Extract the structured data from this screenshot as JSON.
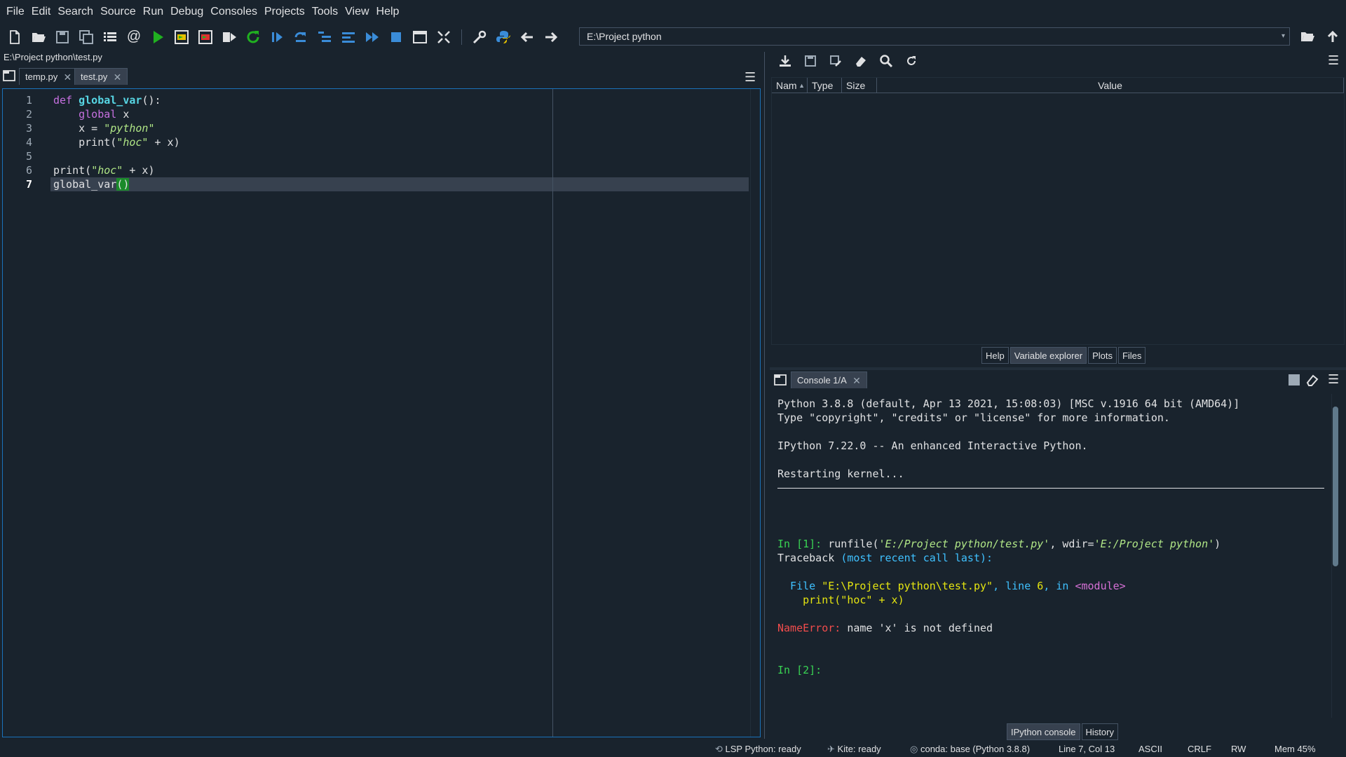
{
  "menu": [
    "File",
    "Edit",
    "Search",
    "Source",
    "Run",
    "Debug",
    "Consoles",
    "Projects",
    "Tools",
    "View",
    "Help"
  ],
  "toolbar": {
    "path": "E:\\Project python",
    "icons": [
      "new-file",
      "open-file",
      "save",
      "save-all",
      "outline",
      "at-sign",
      "run",
      "run-cell",
      "run-cell-advance",
      "run-selection",
      "re-run",
      "debug",
      "step",
      "step-into",
      "step-return",
      "continue",
      "stop",
      "maximize",
      "fullscreen",
      "preferences",
      "python-path",
      "back",
      "forward",
      "browse",
      "parent-directory"
    ]
  },
  "editor": {
    "file_path": "E:\\Project python\\test.py",
    "tabs": [
      {
        "label": "temp.py",
        "active": false
      },
      {
        "label": "test.py",
        "active": true
      }
    ],
    "line_numbers": [
      "1",
      "2",
      "3",
      "4",
      "5",
      "6",
      "7"
    ],
    "current_line": "7",
    "code_tokens": {
      "l1_def": "def ",
      "l1_name": "global_var",
      "l1_rest": "():",
      "l2_kw": "    global ",
      "l2_var": "x",
      "l3_a": "    x = ",
      "l3_str": "\"python\"",
      "l4_a": "    print(",
      "l4_str": "\"hoc\"",
      "l4_b": " + x)",
      "l6_a": "print(",
      "l6_str": "\"hoc\"",
      "l6_b": " + x)",
      "l7_a": "global_var",
      "l7_paren": "()"
    }
  },
  "variable_explorer": {
    "columns": [
      "Nam",
      "Type",
      "Size",
      "Value"
    ],
    "tabs": [
      {
        "label": "Help",
        "active": false
      },
      {
        "label": "Variable explorer",
        "active": true
      },
      {
        "label": "Plots",
        "active": false
      },
      {
        "label": "Files",
        "active": false
      }
    ]
  },
  "console": {
    "tab_label": "Console 1/A",
    "lines": {
      "banner1": "Python 3.8.8 (default, Apr 13 2021, 15:08:03) [MSC v.1916 64 bit (AMD64)]",
      "banner2": "Type \"copyright\", \"credits\" or \"license\" for more information.",
      "banner3": "IPython 7.22.0 -- An enhanced Interactive Python.",
      "restart": "Restarting kernel...",
      "in1_prompt": "In [1]: ",
      "in1_a": "runfile(",
      "in1_s1": "'E:/Project python/test.py'",
      "in1_b": ", wdir=",
      "in1_s2": "'E:/Project python'",
      "in1_c": ")",
      "tb_a": "Traceback ",
      "tb_b": "(most recent call last):",
      "file_a": "  File ",
      "file_b": "\"E:\\Project python\\test.py\"",
      "file_c": ", line ",
      "file_d": "6",
      "file_e": ", in ",
      "file_f": "<module>",
      "src": "    print(\"hoc\" + x)",
      "err_a": "NameError: ",
      "err_b": "name 'x' is not defined",
      "in2_prompt": "In [2]:"
    },
    "bottom_tabs": [
      {
        "label": "IPython console",
        "active": true
      },
      {
        "label": "History",
        "active": false
      }
    ]
  },
  "statusbar": {
    "lsp": "LSP Python: ready",
    "kite": "Kite: ready",
    "conda": "conda: base (Python 3.8.8)",
    "position": "Line 7, Col 13",
    "encoding": "ASCII",
    "eol": "CRLF",
    "mode": "RW",
    "memory": "Mem 45%"
  },
  "colors": {
    "background": "#19232d",
    "keyword": "#c670e0",
    "function": "#57d6e4",
    "string": "#b0e686",
    "prompt": "#39d353",
    "error": "#f14c4c",
    "current_line": "#37414f",
    "run_green": "#20b020"
  }
}
